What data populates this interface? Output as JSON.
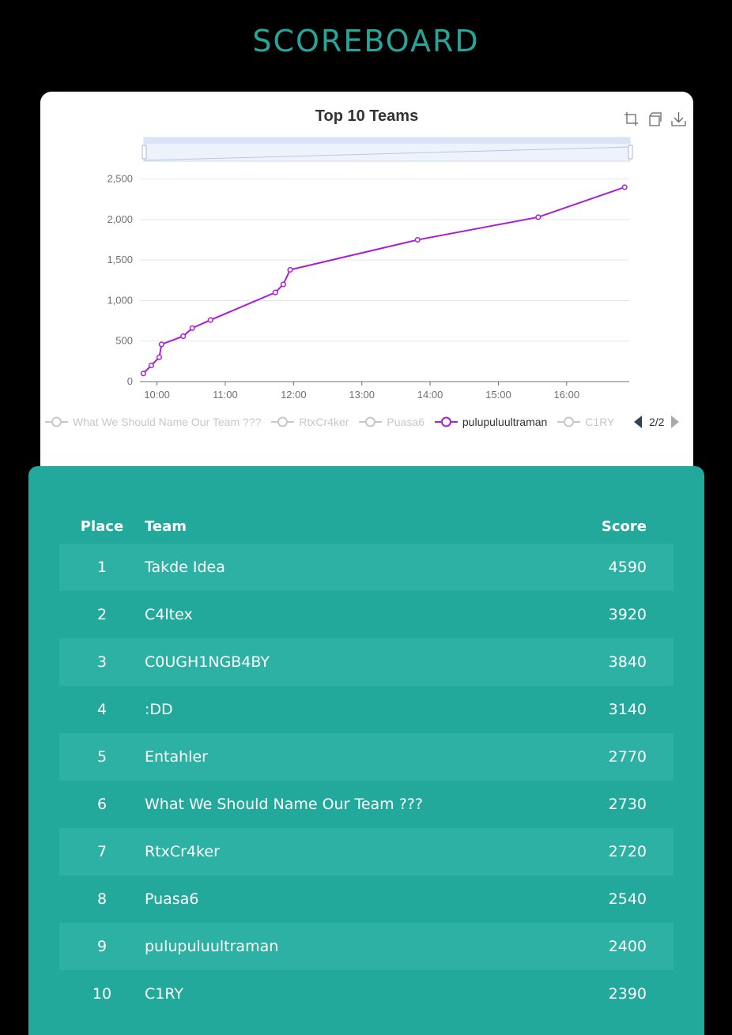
{
  "page": {
    "title": "SCOREBOARD"
  },
  "chart_card": {
    "toolbox": [
      "zoom-icon",
      "reset-zoom-icon",
      "download-icon"
    ],
    "legend": {
      "items": [
        {
          "label": "What We Should Name Our Team ???",
          "active": false
        },
        {
          "label": "RtxCr4ker",
          "active": false
        },
        {
          "label": "Puasa6",
          "active": false
        },
        {
          "label": "pulupuluultraman",
          "active": true
        },
        {
          "label": "C1RY",
          "active": false
        }
      ],
      "page_indicator": "2/2"
    }
  },
  "chart_data": {
    "type": "line",
    "title": "Top 10 Teams",
    "xlabel": "",
    "ylabel": "",
    "x_ticks": [
      "10:00",
      "11:00",
      "12:00",
      "13:00",
      "14:00",
      "15:00",
      "16:00"
    ],
    "y_ticks": [
      "0",
      "500",
      "1,000",
      "1,500",
      "2,000",
      "2,500"
    ],
    "xlim": [
      "09:45",
      "16:55"
    ],
    "ylim": [
      0,
      2750
    ],
    "grid": "horizontal",
    "legend_position": "bottom",
    "dataZoom_slider": "top",
    "series": [
      {
        "name": "pulupuluultraman",
        "color": "#a81ed6",
        "x": [
          "09:48",
          "09:55",
          "10:02",
          "10:04",
          "10:23",
          "10:31",
          "10:47",
          "11:44",
          "11:51",
          "11:57",
          "13:49",
          "15:35",
          "16:51"
        ],
        "y": [
          100,
          200,
          300,
          460,
          560,
          660,
          760,
          1100,
          1200,
          1380,
          1750,
          2030,
          2400
        ]
      }
    ]
  },
  "scoreboard": {
    "headers": {
      "place": "Place",
      "team": "Team",
      "score": "Score"
    },
    "rows": [
      {
        "place": "1",
        "team": "Takde Idea",
        "score": "4590"
      },
      {
        "place": "2",
        "team": "C4ltex",
        "score": "3920"
      },
      {
        "place": "3",
        "team": "C0UGH1NGB4BY",
        "score": "3840"
      },
      {
        "place": "4",
        "team": ":DD",
        "score": "3140"
      },
      {
        "place": "5",
        "team": "Entahler",
        "score": "2770"
      },
      {
        "place": "6",
        "team": "What We Should Name Our Team ???",
        "score": "2730"
      },
      {
        "place": "7",
        "team": "RtxCr4ker",
        "score": "2720"
      },
      {
        "place": "8",
        "team": "Puasa6",
        "score": "2540"
      },
      {
        "place": "9",
        "team": "pulupuluultraman",
        "score": "2400"
      },
      {
        "place": "10",
        "team": "C1RY",
        "score": "2390"
      }
    ]
  },
  "colors": {
    "background": "#000000",
    "accent": "#26a69a",
    "board": "#22a99c",
    "series_active": "#a81ed6",
    "legend_inactive": "#c7c7c7"
  }
}
